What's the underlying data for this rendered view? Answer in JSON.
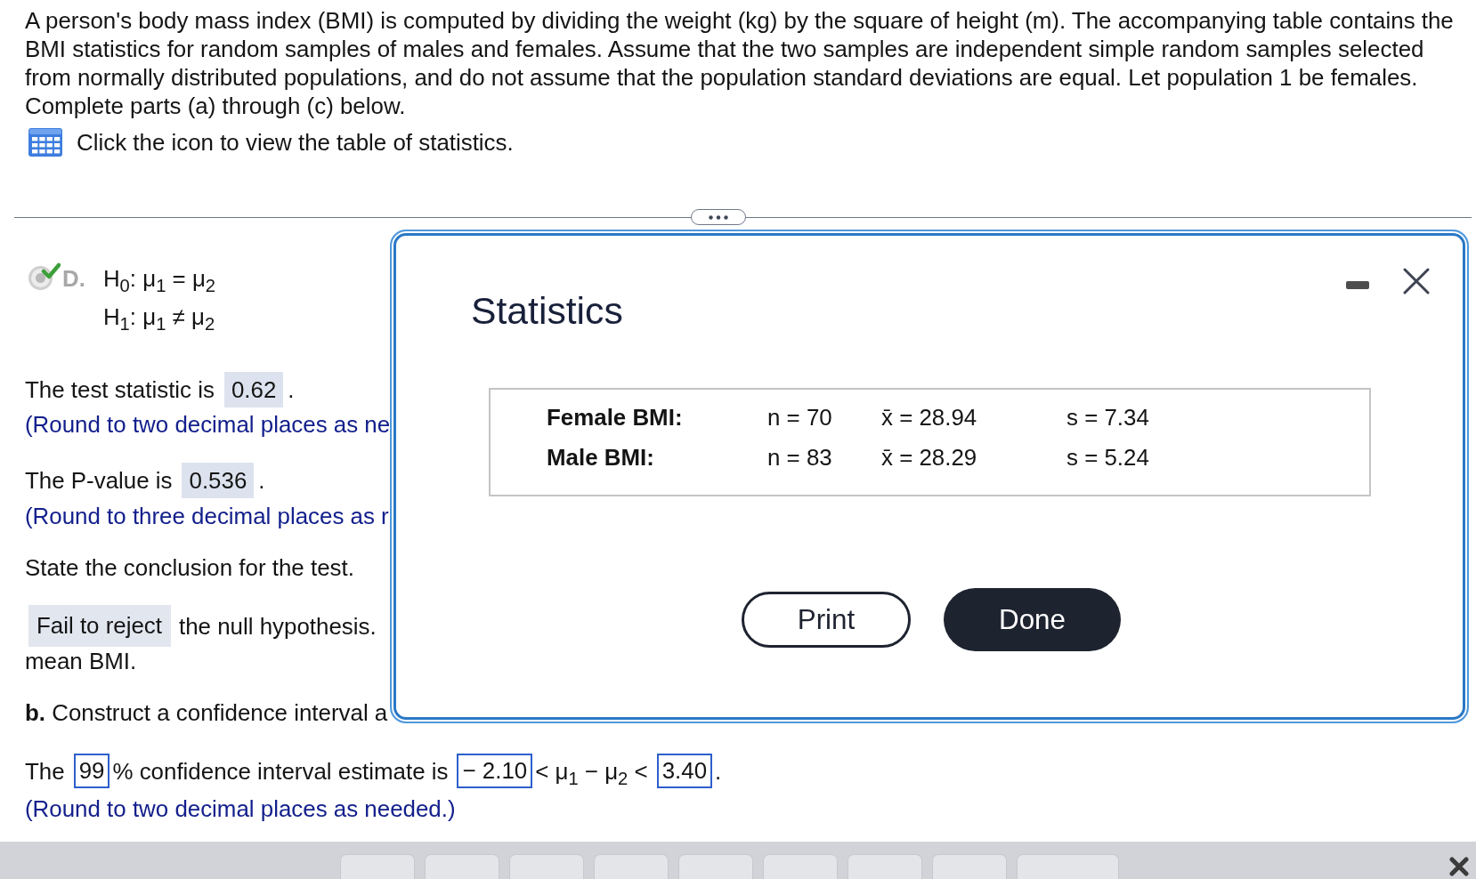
{
  "problem": {
    "text": "A person's body mass index (BMI) is computed by dividing the weight (kg) by the square of height (m). The accompanying table contains the BMI statistics for random samples of males and females. Assume that the two samples are independent simple random samples selected from normally distributed populations, and do not assume that the population standard deviations are equal. Let population 1 be females. Complete parts (a) through (c) below.",
    "table_prompt": "Click the icon to view the table of statistics."
  },
  "part_a": {
    "option": {
      "letter": "D.",
      "selected": true,
      "correct": true,
      "lines": [
        "H$_{0}$: μ$_{1}$ = μ$_{2}$",
        "H$_{1}$: μ$_{1}$ ≠ μ$_{2}$"
      ]
    },
    "test_statistic": {
      "prompt": "The test statistic is",
      "answer": "0.62",
      "end": ".",
      "hint": "(Round to two decimal places as ne"
    },
    "p_value": {
      "prompt": "The P-value is",
      "answer": "0.536",
      "end": ".",
      "hint": "(Round to three decimal places as r"
    },
    "conclusion": {
      "prompt": "State the conclusion for the test.",
      "answer": "Fail to reject",
      "text": "the null hypothesis.",
      "continuation": "mean BMI."
    }
  },
  "part_b": {
    "prompt": "**b.** Construct a confidence interval a",
    "sentence": [
      {
        "kind": "text",
        "text": "The"
      },
      {
        "kind": "answer",
        "value": "99"
      },
      {
        "kind": "text",
        "text": "% confidence interval estimate is"
      },
      {
        "kind": "answer",
        "value": "− 2.10"
      },
      {
        "kind": "text",
        "text": "< μ$_{1}$ − μ$_{2}$ <"
      },
      {
        "kind": "answer",
        "value": "3.40"
      },
      {
        "kind": "text",
        "text": "."
      }
    ],
    "hint": "(Round to two decimal places as needed.)"
  },
  "dialog": {
    "title": "Statistics",
    "rows": [
      {
        "label": "Female BMI:",
        "n": "n = 70",
        "mean": "x̄ = 28.94",
        "sd": "s = 7.34"
      },
      {
        "label": "Male BMI:",
        "n": "n = 83",
        "mean": "x̄ = 28.29",
        "sd": "s = 5.24"
      }
    ],
    "buttons": [
      {
        "label": "Print",
        "kind": "outline"
      },
      {
        "label": "Done",
        "kind": "solid"
      }
    ]
  },
  "toolbar": {
    "keys": [
      {
        "kind": "standard"
      },
      {
        "kind": "standard"
      },
      {
        "kind": "standard"
      },
      {
        "kind": "standard"
      },
      {
        "kind": "standard"
      },
      {
        "kind": "standard"
      },
      {
        "kind": "standard"
      },
      {
        "kind": "standard"
      },
      {
        "kind": "wide"
      }
    ]
  }
}
